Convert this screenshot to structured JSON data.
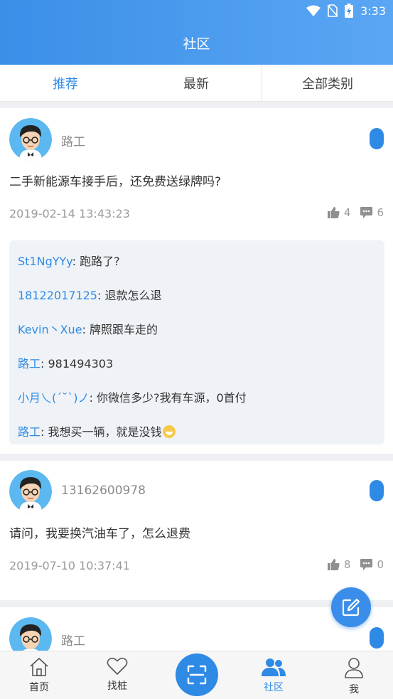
{
  "status_bar": {
    "time": "3:33",
    "icons": [
      "wifi-icon",
      "no-sim-icon",
      "battery-charging-icon"
    ]
  },
  "header": {
    "title": "社区"
  },
  "tabs": [
    {
      "label": "推荐",
      "active": true
    },
    {
      "label": "最新",
      "active": false
    },
    {
      "label": "全部类别",
      "active": false
    }
  ],
  "posts": [
    {
      "author": "路工",
      "content": "二手新能源车接手后，还免费送绿牌吗?",
      "time": "2019-02-14 13:43:23",
      "likes": "4",
      "comments_count": "6",
      "comments": [
        {
          "name": "St1NgYYy",
          "sep": ": ",
          "text": "跑路了?"
        },
        {
          "name": "18122017125",
          "sep": ": ",
          "text": "退款怎么退"
        },
        {
          "name": "Kevin丶Xue",
          "sep": ": ",
          "text": "牌照跟车走的"
        },
        {
          "name": "路工",
          "sep": ": ",
          "text": "981494303"
        },
        {
          "name": "小月乀(ˊ˘ˋ)ノ",
          "sep": ": ",
          "text": "你微信多少?我有车源，0首付"
        },
        {
          "name": "路工",
          "sep": ": ",
          "text": "我想买一辆，就是没钱",
          "emoji": "grin-emoji"
        }
      ]
    },
    {
      "author": "13162600978",
      "content": "请问，我要换汽油车了，怎么退费",
      "time": "2019-07-10 10:37:41",
      "likes": "8",
      "comments_count": "0"
    },
    {
      "author": "路工"
    }
  ],
  "fab": {
    "icon": "edit-icon"
  },
  "bottom_nav": [
    {
      "label": "首页",
      "icon": "home-icon",
      "active": false
    },
    {
      "label": "找桩",
      "icon": "heart-icon",
      "active": false
    },
    {
      "label": "",
      "icon": "scan-icon",
      "active": false
    },
    {
      "label": "社区",
      "icon": "community-icon",
      "active": true
    },
    {
      "label": "我",
      "icon": "user-icon",
      "active": false
    }
  ],
  "colors": {
    "accent": "#2f8ae5",
    "header_start": "#3b8fe8",
    "header_end": "#5aa6f4"
  }
}
